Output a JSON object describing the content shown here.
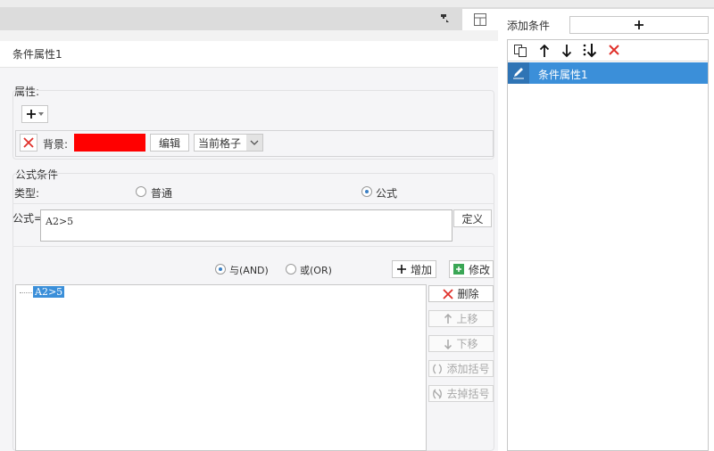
{
  "right_panel": {
    "add_condition_label": "添加条件",
    "add_button_label": "+",
    "list_items": [
      {
        "label": "条件属性1",
        "selected": true
      }
    ]
  },
  "editor": {
    "title": "条件属性1",
    "attribute_section_label": "属性:",
    "background_label": "背景:",
    "background_color": "#ff0000",
    "edit_button_label": "编辑",
    "apply_scope_value": "当前格子",
    "formula_section_label": "公式条件",
    "type_label": "类型:",
    "type_options": [
      "普通",
      "公式"
    ],
    "type_selected": "公式",
    "formula_label": "公式=",
    "formula_value": "A2>5",
    "define_button_label": "定义",
    "logic_options": [
      "与(AND)",
      "或(OR)"
    ],
    "logic_selected": "与(AND)",
    "add_button_label": "增加",
    "modify_button_label": "修改",
    "condition_tree_items": [
      "A2>5"
    ],
    "delete_button_label": "删除",
    "move_up_label": "上移",
    "move_down_label": "下移",
    "add_bracket_label": "添加括号",
    "remove_bracket_label": "去掉括号"
  },
  "colors": {
    "accent": "#3b8fd9",
    "danger": "#e0302a",
    "selection": "#3b8fd9"
  }
}
